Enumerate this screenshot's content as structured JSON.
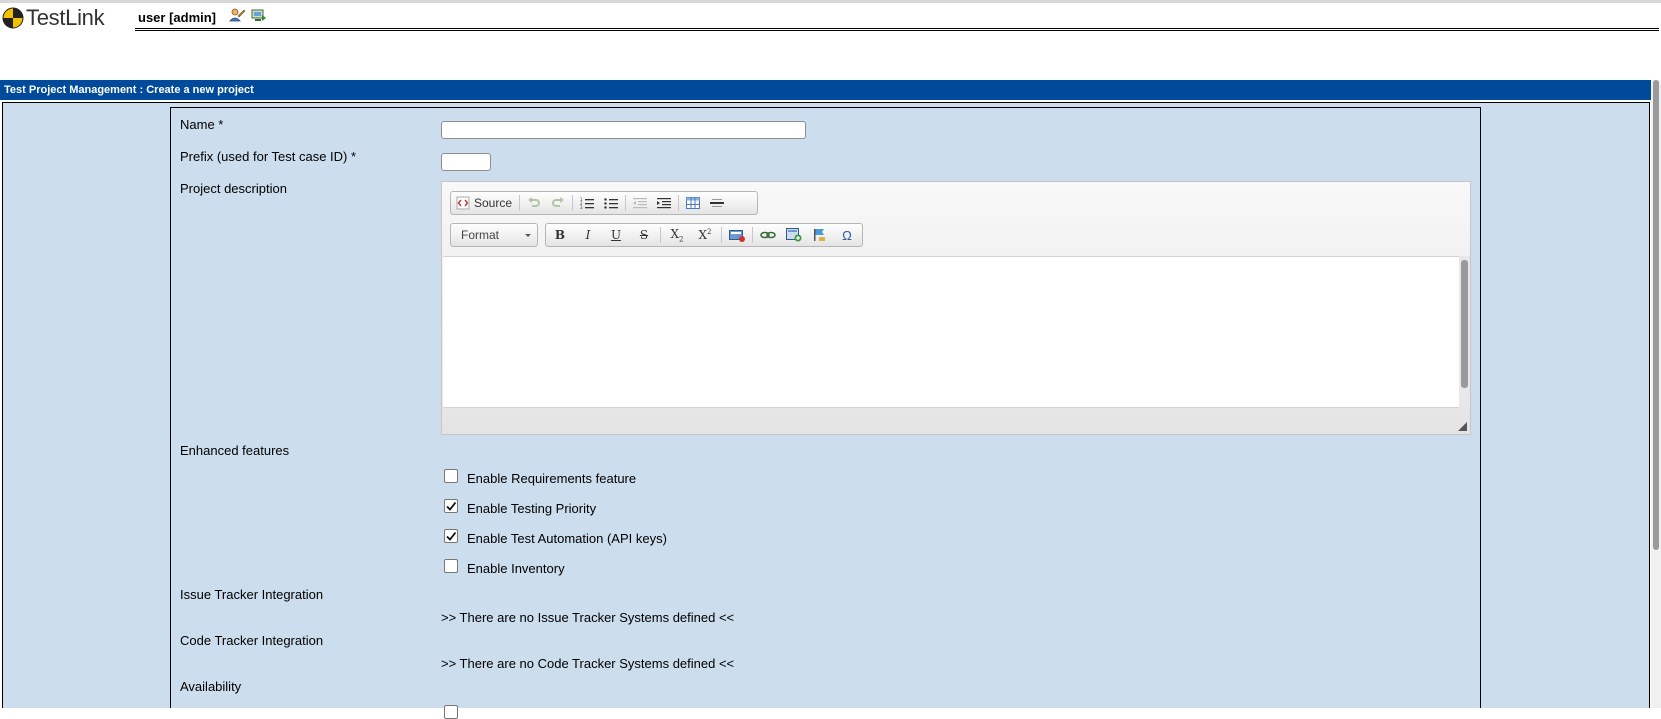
{
  "header": {
    "logo_text": "TestLink",
    "user_label": "user [admin]",
    "icons": [
      "user-settings-icon",
      "logout-icon"
    ]
  },
  "page": {
    "title": "Test Project Management : Create a new project"
  },
  "form": {
    "name_label": "Name *",
    "name_value": "",
    "prefix_label": "Prefix (used for Test case ID) *",
    "prefix_value": "",
    "description_label": "Project description",
    "editor": {
      "source_label": "Source",
      "format_label": "Format",
      "content": ""
    },
    "enhanced_label": "Enhanced features",
    "features": [
      {
        "label": "Enable Requirements feature",
        "checked": false
      },
      {
        "label": "Enable Testing Priority",
        "checked": true
      },
      {
        "label": "Enable Test Automation (API keys)",
        "checked": true
      },
      {
        "label": "Enable Inventory",
        "checked": false
      }
    ],
    "issue_tracker_label": "Issue Tracker Integration",
    "issue_tracker_message": ">> There are no Issue Tracker Systems defined <<",
    "code_tracker_label": "Code Tracker Integration",
    "code_tracker_message": ">> There are no Code Tracker Systems defined <<",
    "availability_label": "Availability"
  },
  "colors": {
    "title_bar": "#004a9c",
    "panel_bg": "#ccddee"
  }
}
